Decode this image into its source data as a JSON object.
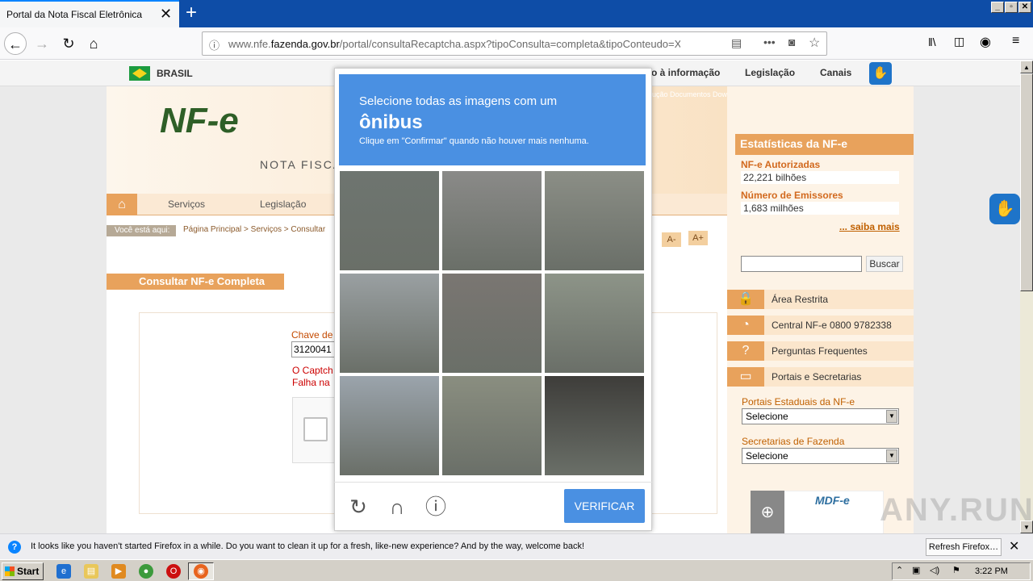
{
  "browser": {
    "tab_title": "Portal da Nota Fiscal Eletrônica",
    "url_prefix": "www.nfe.",
    "url_domain": "fazenda.gov.br",
    "url_path": "/portal/consultaRecaptcha.aspx?tipoConsulta=completa&tipoConteudo=XbSeq",
    "win_minimize": "_",
    "win_restore": "▫",
    "win_close": "✕"
  },
  "gov_bar": {
    "brasil": "BRASIL",
    "acesso": "o à informação",
    "legislacao": "Legislação",
    "canais": "Canais"
  },
  "site": {
    "logo": "NF-e",
    "logo_sub": "NOTA FISCA",
    "top_links": "ução  Documentos  Downloads  Área Restrita  Documentos e outros",
    "menu": [
      "Serviços",
      "Legislação"
    ],
    "breadcrumb_label": "Você está aqui:",
    "breadcrumb": "Página Principal > Serviços > Consultar",
    "font_decrease": "A-",
    "font_increase": "A+",
    "page_title": "Consultar NF-e Completa",
    "chave_label": "Chave de",
    "chave_value": "3120041",
    "captcha_err1": "O Captch",
    "captcha_err2": "Falha na"
  },
  "sidebar": {
    "stats_title": "Estatísticas da NF-e",
    "autorizadas_label": "NF-e Autorizadas",
    "autorizadas_value": "22,221 bilhões",
    "emissores_label": "Número de Emissores",
    "emissores_value": "1,683 milhões",
    "saiba_mais": "... saiba mais",
    "search_button": "Buscar",
    "items": [
      "Área Restrita",
      "Central NF-e 0800 9782338",
      "Perguntas Frequentes",
      "Portais e Secretarias"
    ],
    "portais_label": "Portais Estaduais da NF-e",
    "portais_value": "Selecione",
    "secretarias_label": "Secretarias de Fazenda",
    "secretarias_value": "Selecione",
    "mdfe": "MDF-e"
  },
  "captcha": {
    "line1": "Selecione todas as imagens com um",
    "target": "ônibus",
    "line3": "Clique em \"Confirmar\" quando não houver mais nenhuma.",
    "verify": "VERIFICAR",
    "tiles": [
      "#6e7570",
      "#8a8a88",
      "#8b8e86",
      "#9aa0a2",
      "#7a7672",
      "#8d9488",
      "#9ba4ac",
      "#8a8e80",
      "#3e3d3a"
    ]
  },
  "notification": {
    "text": "It looks like you haven't started Firefox in a while. Do you want to clean it up for a fresh, like-new experience? And by the way, welcome back!",
    "button": "Refresh Firefox…"
  },
  "taskbar": {
    "start": "Start",
    "clock": "3:22 PM"
  },
  "watermark": "ANY.RUN",
  "colors": {
    "accent_orange": "#e8a25c",
    "captcha_blue": "#4a90e2",
    "firefox_blue": "#0e4da7"
  }
}
